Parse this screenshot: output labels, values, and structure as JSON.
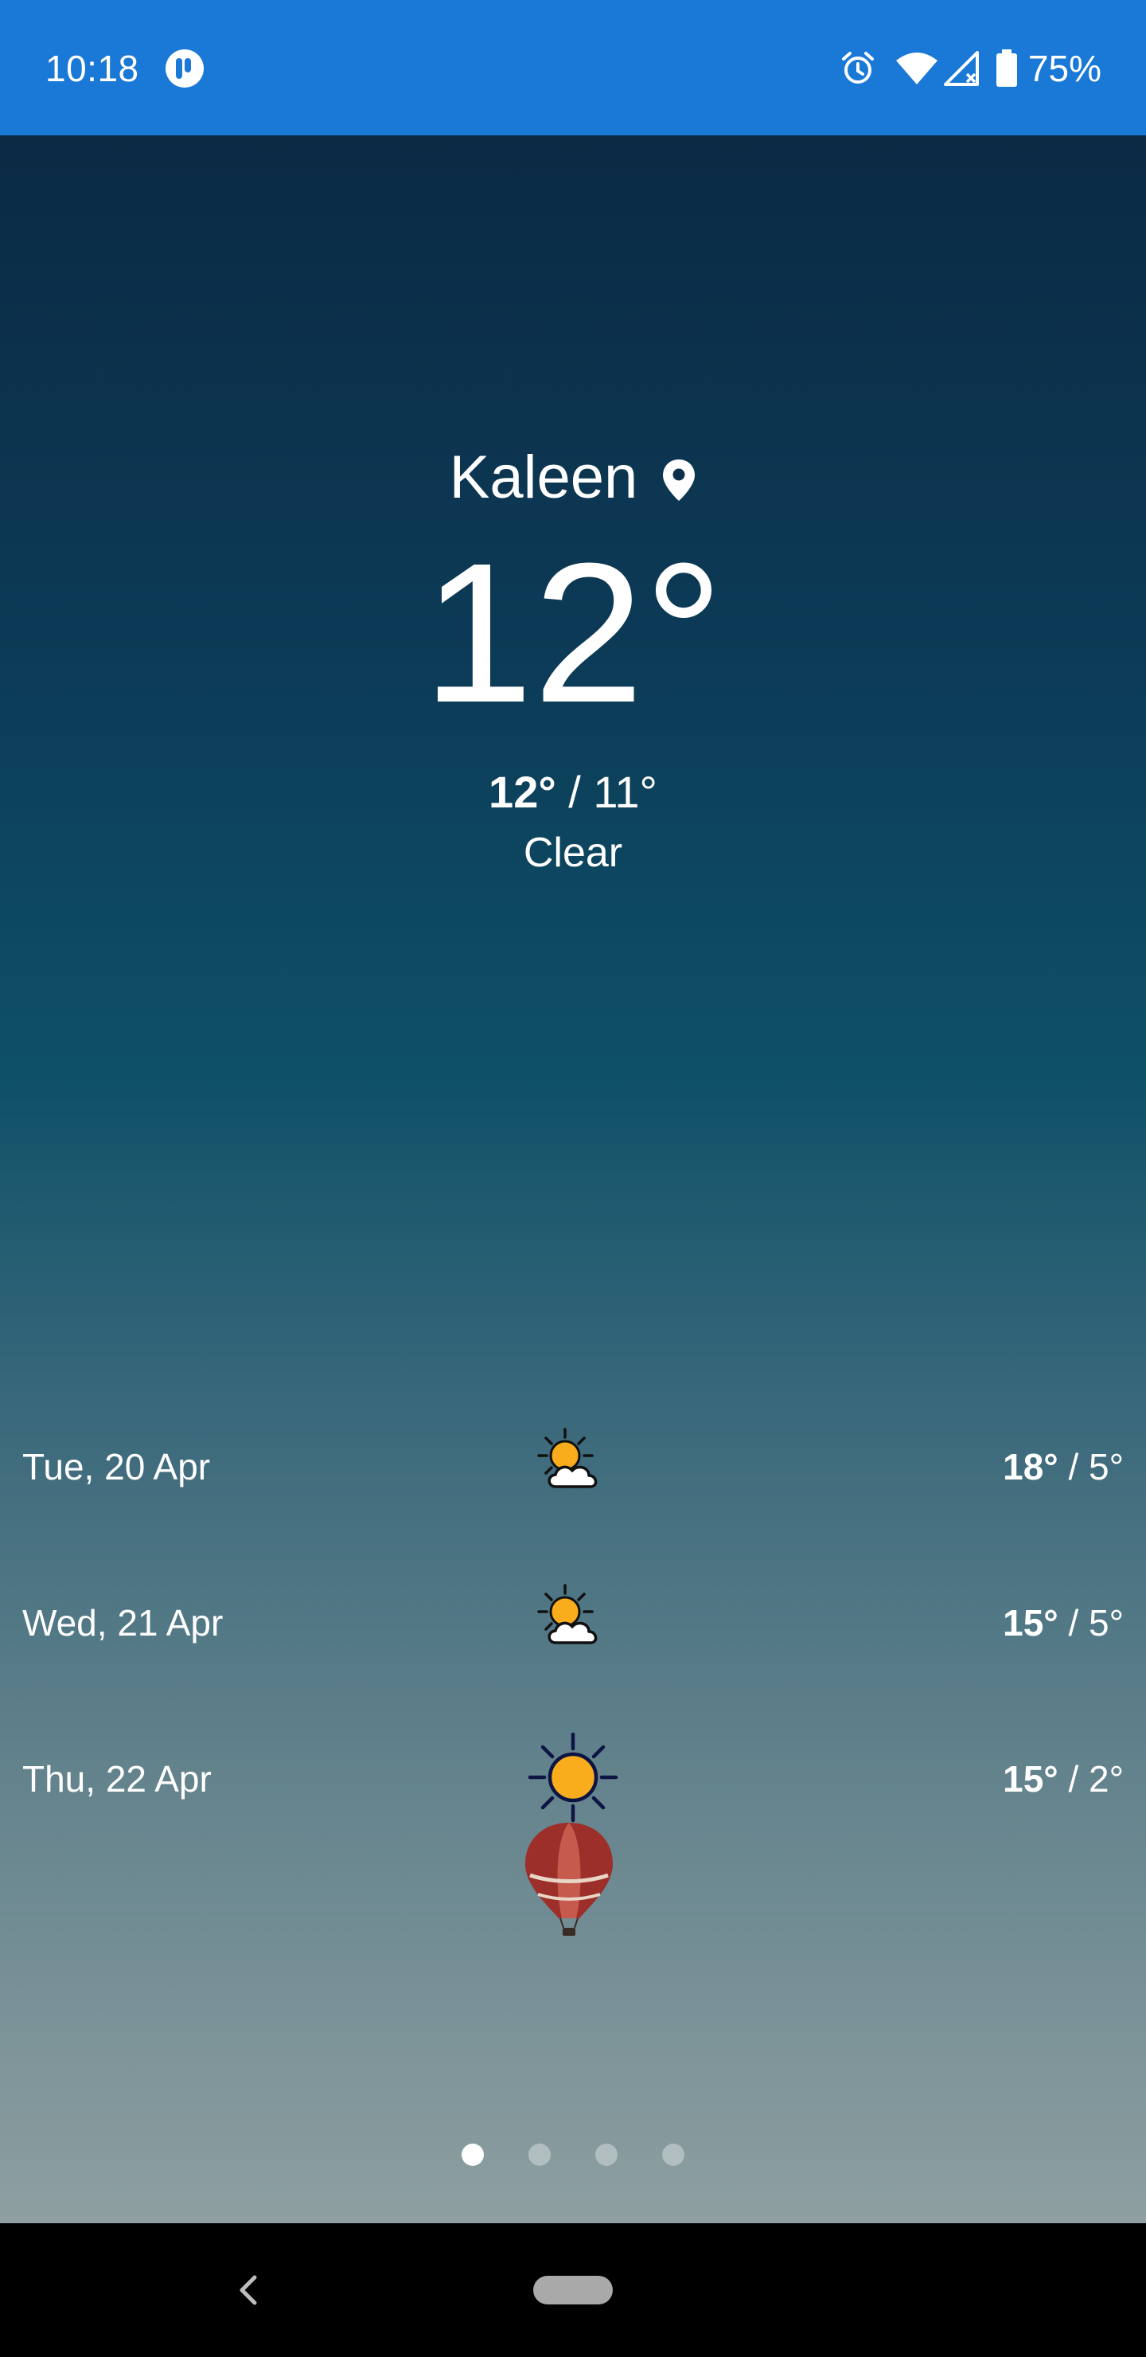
{
  "status_bar": {
    "time": "10:18",
    "battery": "75%",
    "icons": [
      "app-indicator-icon",
      "alarm-icon",
      "wifi-icon",
      "cell-signal-icon",
      "battery-icon"
    ],
    "color": "#1a78d6"
  },
  "current": {
    "location": "Kaleen",
    "temperature": "12°",
    "high": "12°",
    "separator": " / ",
    "low": "11°",
    "condition": "Clear"
  },
  "forecast": [
    {
      "date": "Tue, 20 Apr",
      "icon": "partly-cloudy-icon",
      "high": "18°",
      "low": "5°"
    },
    {
      "date": "Wed, 21 Apr",
      "icon": "partly-cloudy-icon",
      "high": "15°",
      "low": "5°"
    },
    {
      "date": "Thu, 22 Apr",
      "icon": "sunny-icon",
      "high": "15°",
      "low": "2°"
    }
  ],
  "pager": {
    "pages": 4,
    "active": 1
  },
  "colors": {
    "sun": "#f9ad1d",
    "sun_outline": "#0d1545",
    "cloud": "#ffffff",
    "balloon": "#9c2f2a"
  }
}
